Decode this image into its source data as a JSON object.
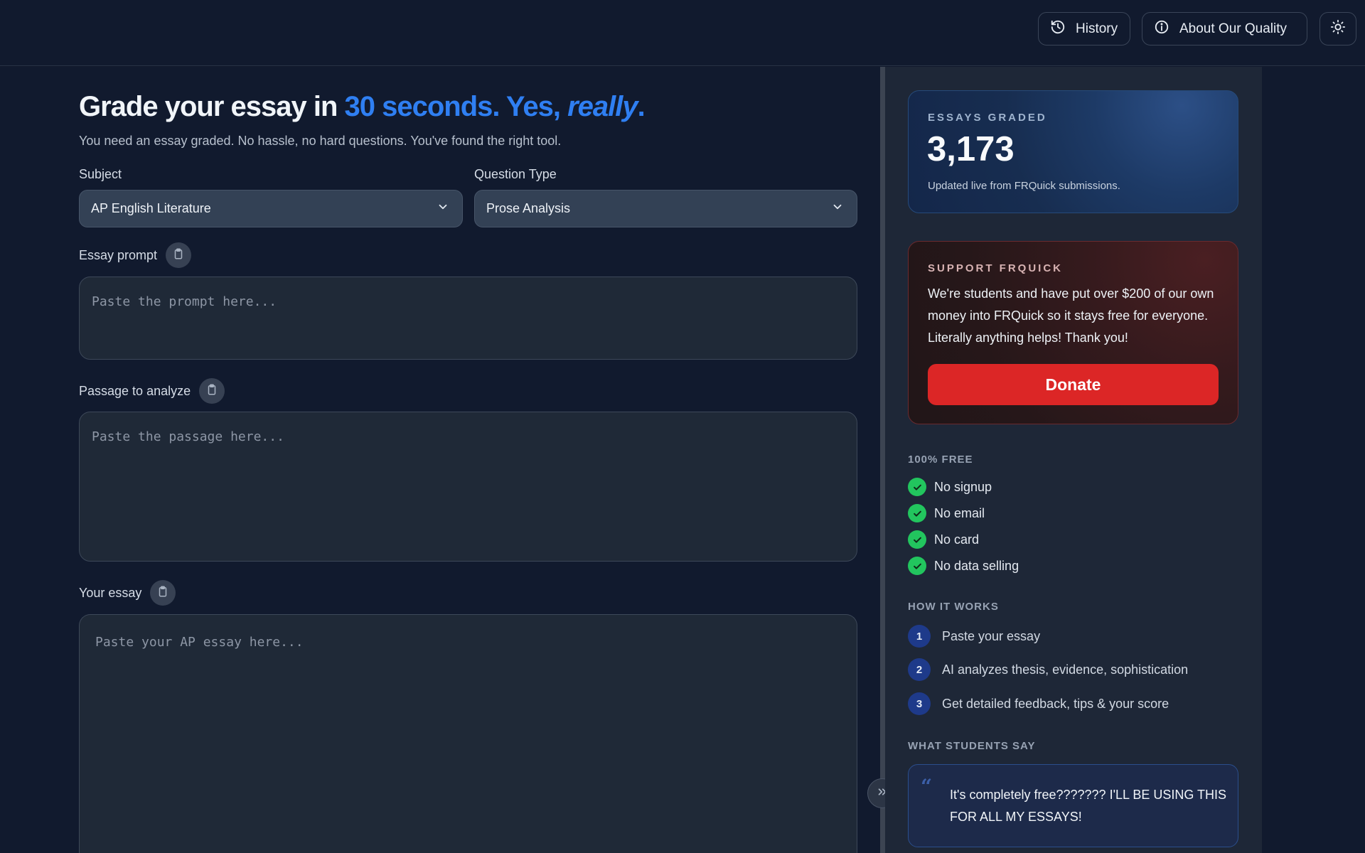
{
  "header": {
    "history_label": "History",
    "about_label": "About Our Quality",
    "history_icon": "history-icon",
    "about_icon": "info-icon",
    "theme_icon": "sun-icon"
  },
  "main": {
    "title_start": "Grade your essay in ",
    "title_accent": "30 seconds. Yes, ",
    "title_italic": "really",
    "title_end": ".",
    "subtitle": "You need an essay graded. No hassle, no hard questions. You've found the right tool.",
    "subject_label": "Subject",
    "subject_value": "AP English Literature",
    "qtype_label": "Question Type",
    "qtype_value": "Prose Analysis",
    "prompt_label": "Essay prompt",
    "prompt_placeholder": "Paste the prompt here...",
    "passage_label": "Passage to analyze",
    "passage_placeholder": "Paste the passage here...",
    "essay_label": "Your essay",
    "essay_placeholder": "Paste your AP essay here..."
  },
  "sidebar": {
    "graded_kicker": "ESSAYS GRADED",
    "graded_count": "3,173",
    "graded_note": "Updated live from FRQuick submissions.",
    "support_kicker": "SUPPORT FRQUICK",
    "support_text": "We're students and have put over $200 of our own money into FRQuick so it stays free for everyone. Literally anything helps! Thank you!",
    "donate_label": "Donate",
    "free_head": "100% FREE",
    "free_items": [
      "No signup",
      "No email",
      "No card",
      "No data selling"
    ],
    "how_head": "HOW IT WORKS",
    "steps": [
      {
        "num": "1",
        "text": "Paste your essay"
      },
      {
        "num": "2",
        "text": "AI analyzes thesis, evidence, sophistication"
      },
      {
        "num": "3",
        "text": "Get detailed feedback, tips & your score"
      }
    ],
    "say_head": "WHAT STUDENTS SAY",
    "quote_mark": "“",
    "quote": "It's completely free??????? I'LL BE USING THIS FOR ALL MY ESSAYS!"
  },
  "colors": {
    "accent": "#2f7ff2",
    "donate": "#dc2626",
    "check": "#22c55e",
    "background": "#111a2e"
  }
}
